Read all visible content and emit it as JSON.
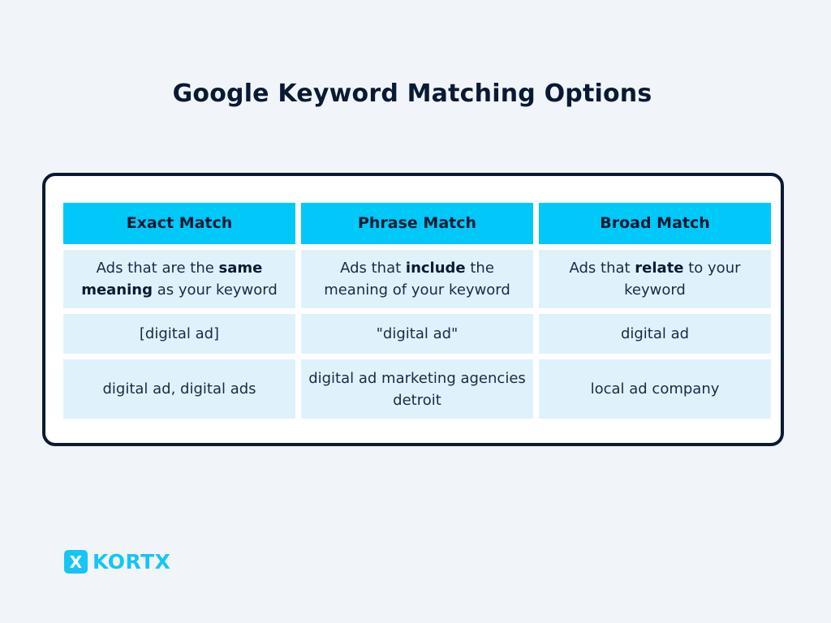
{
  "title": "Google Keyword Matching Options",
  "colors": {
    "background": "#f1f5f9",
    "header_fill": "#00c8f8",
    "cell_fill": "#dff2fc",
    "border": "#0b1a33",
    "brand": "#16c5f5"
  },
  "table": {
    "headers": [
      "Exact Match",
      "Phrase Match",
      "Broad Match"
    ],
    "rows": [
      [
        [
          {
            "text": "Ads that are the "
          },
          {
            "text": "same meaning",
            "bold": true
          },
          {
            "text": " as your keyword"
          }
        ],
        [
          {
            "text": "Ads that "
          },
          {
            "text": "include",
            "bold": true
          },
          {
            "text": " the meaning of your keyword"
          }
        ],
        [
          {
            "text": "Ads that "
          },
          {
            "text": "relate",
            "bold": true
          },
          {
            "text": " to your keyword"
          }
        ]
      ],
      [
        [
          {
            "text": "[digital ad]"
          }
        ],
        [
          {
            "text": "\"digital ad\""
          }
        ],
        [
          {
            "text": "digital ad"
          }
        ]
      ],
      [
        [
          {
            "text": "digital ad, digital ads"
          }
        ],
        [
          {
            "text": "digital ad marketing agencies detroit"
          }
        ],
        [
          {
            "text": "local ad company"
          }
        ]
      ]
    ]
  },
  "logo": {
    "mark": "X",
    "text": "KORTX",
    "icon": "kortx-logo-icon"
  }
}
